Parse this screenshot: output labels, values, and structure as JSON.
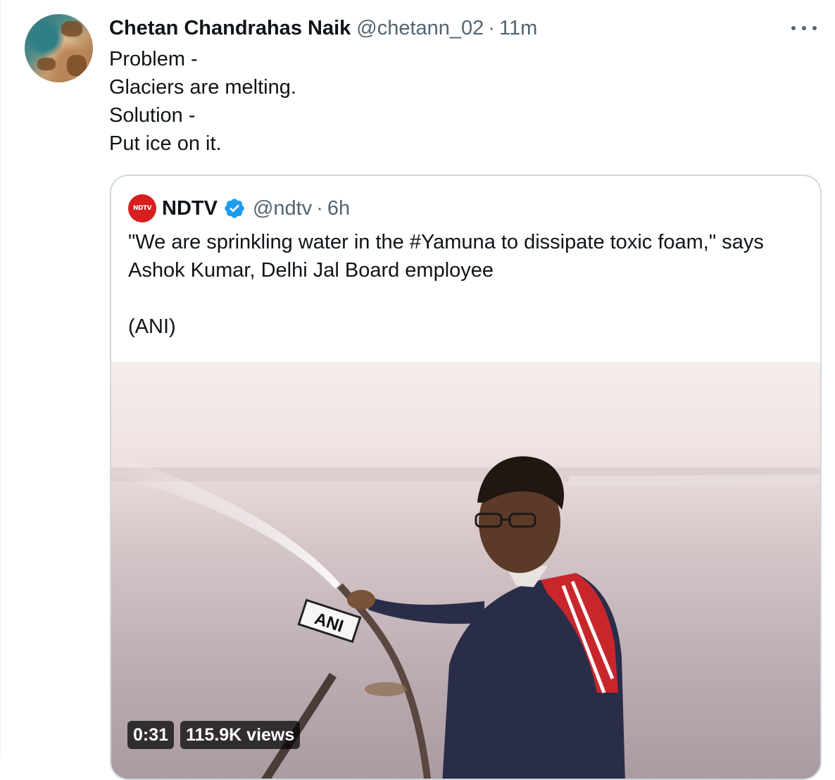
{
  "tweet": {
    "display_name": "Chetan Chandrahas Naik",
    "handle": "@chetann_02",
    "separator": "·",
    "time": "11m",
    "lines": [
      "Problem -",
      "Glaciers are melting.",
      "Solution -",
      "Put ice on it."
    ],
    "more_icon": "more-horizontal-icon"
  },
  "quote": {
    "avatar_label": "NDTV",
    "display_name": "NDTV",
    "verified_icon": "verified-badge-icon",
    "handle": "@ndtv",
    "separator": "·",
    "time": "6h",
    "lines": [
      "\"We are sprinkling water in the #Yamuna to dissipate toxic foam,\" says",
      "Ashok Kumar, Delhi Jal Board employee",
      "",
      "(ANI)"
    ],
    "video": {
      "duration": "0:31",
      "views": "115.9K views",
      "mic_label": "ANI"
    }
  },
  "colors": {
    "text": "#0f1419",
    "secondary": "#536471",
    "border": "#cfd9de",
    "verified": "#1d9bf0",
    "ndtv_red": "#d81e1e"
  }
}
